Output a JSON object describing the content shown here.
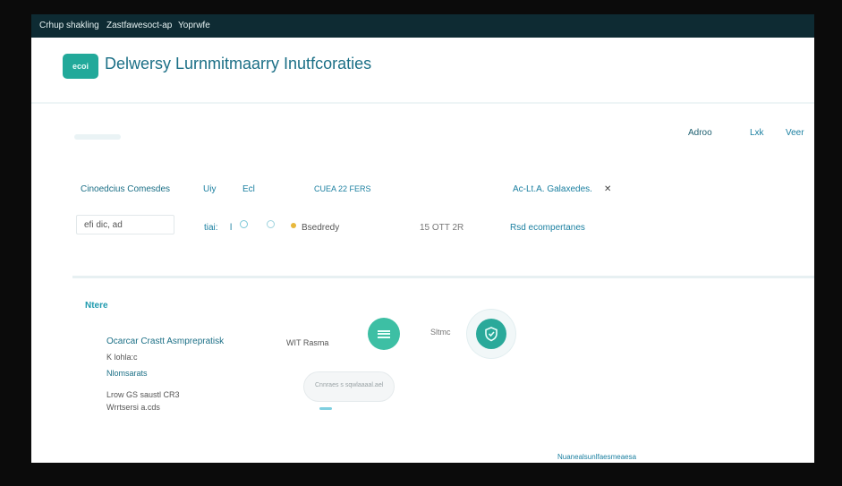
{
  "titlebar": {
    "left": "Crhup shakling",
    "middle": "Zastfawesoct-ap",
    "right": "Yoprwfe"
  },
  "header": {
    "logo_text": "ecoi",
    "title": "Delwersy Lurnmitmaarry Inutfcoraties",
    "nav": [
      "Adroo",
      "Lxk",
      "Veer"
    ]
  },
  "filters": {
    "label": "Cinoedcius Comesdes",
    "items": [
      "Uiy",
      "Ecl",
      "CUEA 22 FERS",
      "Ac-Lt.A. Galaxedes."
    ],
    "close_glyph": "✕"
  },
  "row": {
    "input_value": "efi dic, ad",
    "small_a": "tiai:",
    "small_b": "l",
    "status_text": "Bsedredy",
    "date": "15 OTT 2R",
    "link": "Rsd ecompertanes"
  },
  "section": {
    "label": "Ntere",
    "item_title": "Ocarcar Crastt Asmprepratisk",
    "item_sub": "K lohla:c",
    "item_meta": "Nlomsarats",
    "line1": "Lrow GS saustl CR3",
    "line2": "Wrrtsersi a.cds",
    "tag": "WIT Rasma",
    "circle_label": "Sltmc",
    "preview_text": "Cnnraes  s  sqwlaaaal.ael"
  },
  "footer": {
    "link": "Nuanealsunlfaesmeaesa"
  },
  "colors": {
    "accent": "#22a99a",
    "titlebar": "#0e2b33",
    "link": "#1a7fa0",
    "title": "#1b6f86"
  }
}
